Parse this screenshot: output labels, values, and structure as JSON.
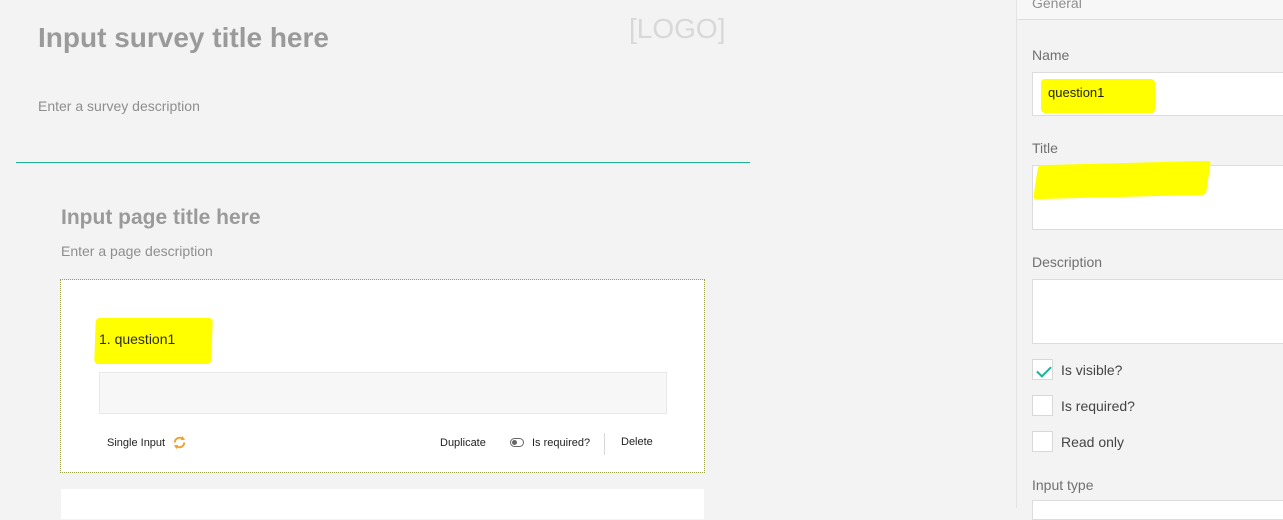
{
  "survey": {
    "title": "Input survey title here",
    "logo": "[LOGO]",
    "description": "Enter a survey description"
  },
  "page": {
    "title": "Input page title here",
    "description": "Enter a page description"
  },
  "question": {
    "title": "1. question1",
    "type_label": "Single Input",
    "duplicate_label": "Duplicate",
    "required_label": "Is required?",
    "delete_label": "Delete"
  },
  "panel": {
    "tab_label": "General",
    "name_label": "Name",
    "name_value": "question1",
    "title_label": "Title",
    "description_label": "Description",
    "visible_label": "Is visible?",
    "visible_checked": true,
    "required_label": "Is required?",
    "required_checked": false,
    "readonly_label": "Read only",
    "readonly_checked": false,
    "input_type_label": "Input type"
  },
  "colors": {
    "accent": "#1ab394",
    "highlight": "#ffff00",
    "icon_orange": "#f0a030"
  }
}
